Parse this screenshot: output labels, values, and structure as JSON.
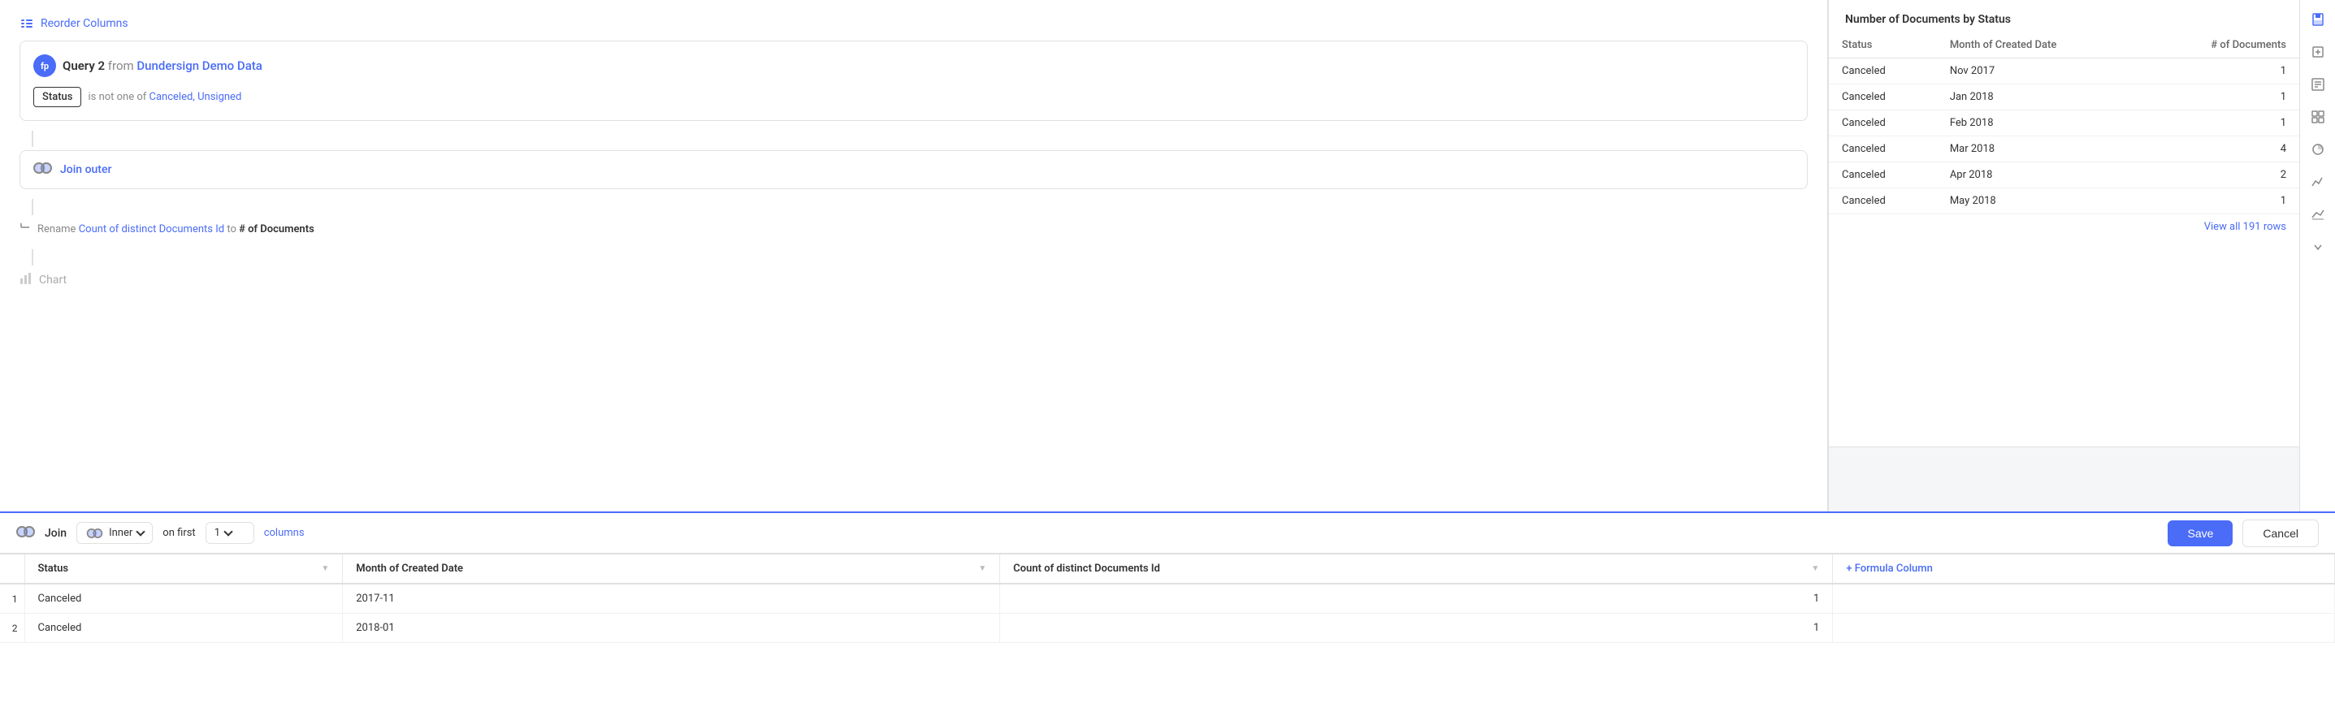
{
  "pipeline": {
    "reorder_label": "Reorder Columns",
    "query2": {
      "title": "Query 2",
      "from_label": "from",
      "source": "Dundersign Demo Data",
      "filter_field": "Status",
      "filter_operator": "is not one of",
      "filter_values": "Canceled,  Unsigned"
    },
    "join_outer": {
      "label": "Join outer"
    },
    "rename": {
      "action": "Rename",
      "field": "Count of distinct Documents Id",
      "arrow": "to",
      "new_name": "# of Documents"
    },
    "chart": {
      "label": "Chart"
    }
  },
  "preview": {
    "title": "Number of Documents by Status",
    "columns": [
      "Status",
      "Month of Created Date",
      "# of Documents"
    ],
    "rows": [
      [
        "Canceled",
        "Nov 2017",
        "1"
      ],
      [
        "Canceled",
        "Jan 2018",
        "1"
      ],
      [
        "Canceled",
        "Feb 2018",
        "1"
      ],
      [
        "Canceled",
        "Mar 2018",
        "4"
      ],
      [
        "Canceled",
        "Apr 2018",
        "2"
      ],
      [
        "Canceled",
        "May 2018",
        "1"
      ]
    ],
    "view_all": "View all 191 rows"
  },
  "join_bar": {
    "join_label": "Join",
    "join_type": "Inner",
    "on_first": "on first",
    "columns_value": "1",
    "columns_label": "columns",
    "save_label": "Save",
    "cancel_label": "Cancel"
  },
  "data_table": {
    "columns": [
      {
        "label": "Status",
        "type": "text"
      },
      {
        "label": "Month of Created Date",
        "type": "text"
      },
      {
        "label": "Count of distinct Documents Id",
        "type": "number"
      },
      {
        "label": "+ Formula Column",
        "type": "formula"
      }
    ],
    "rows": [
      {
        "num": "1",
        "status": "Canceled",
        "month": "2017-11",
        "count": "1"
      },
      {
        "num": "2",
        "status": "Canceled",
        "month": "2018-01",
        "count": "1"
      }
    ]
  }
}
